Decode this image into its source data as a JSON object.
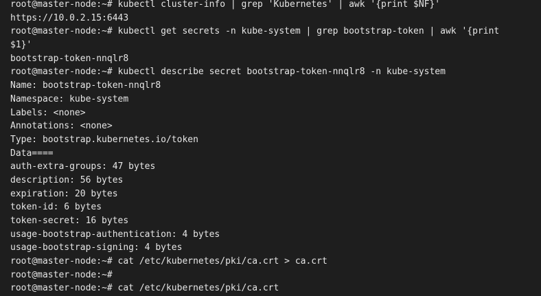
{
  "terminal": {
    "lines": [
      "root@master-node:~# kubectl cluster-info | grep 'Kubernetes' | awk '{print $NF}'",
      "https://10.0.2.15:6443",
      "root@master-node:~# kubectl get secrets -n kube-system | grep bootstrap-token | awk '{print",
      "$1}'",
      "bootstrap-token-nnqlr8",
      "root@master-node:~# kubectl describe secret bootstrap-token-nnqlr8 -n kube-system",
      "Name: bootstrap-token-nnqlr8",
      "Namespace: kube-system",
      "Labels: <none>",
      "Annotations: <none>",
      "Type: bootstrap.kubernetes.io/token",
      "Data====",
      "auth-extra-groups: 47 bytes",
      "description: 56 bytes",
      "expiration: 20 bytes",
      "token-id: 6 bytes",
      "token-secret: 16 bytes",
      "usage-bootstrap-authentication: 4 bytes",
      "usage-bootstrap-signing: 4 bytes",
      "root@master-node:~# cat /etc/kubernetes/pki/ca.crt > ca.crt",
      "root@master-node:~#",
      "root@master-node:~# cat /etc/kubernetes/pki/ca.crt"
    ]
  }
}
